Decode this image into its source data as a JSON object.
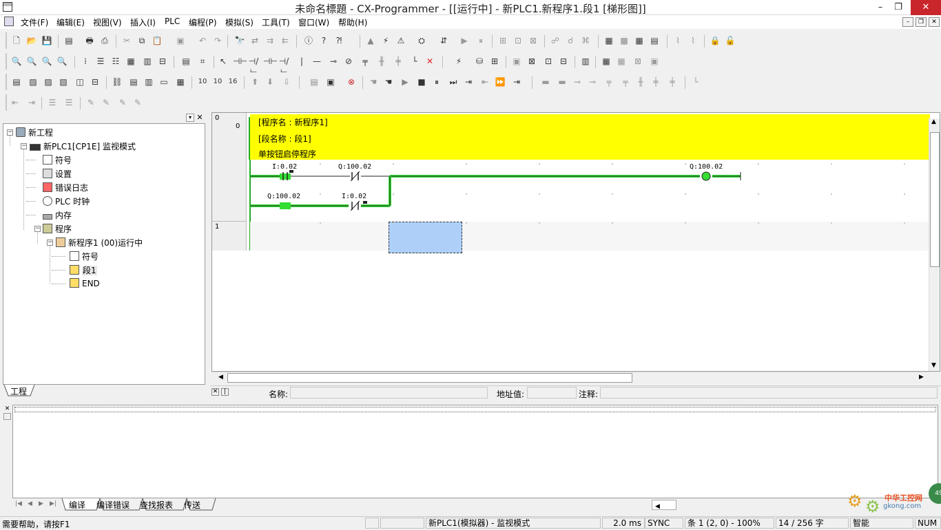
{
  "window": {
    "title": "未命名標題 - CX-Programmer - [[运行中] - 新PLC1.新程序1.段1 [梯形图]]",
    "minimize": "–",
    "restore": "❐",
    "close": "✕"
  },
  "menu": [
    "文件(F)",
    "编辑(E)",
    "视图(V)",
    "插入(I)",
    "PLC",
    "编程(P)",
    "模拟(S)",
    "工具(T)",
    "窗口(W)",
    "帮助(H)"
  ],
  "tree": {
    "root": "新工程",
    "plc": "新PLC1[CP1E] 监视模式",
    "items": [
      "符号",
      "设置",
      "错误日志",
      "PLC 时钟",
      "内存"
    ],
    "programs": "程序",
    "program1": "新程序1 (00)运行中",
    "sub_items": [
      "符号",
      "段1",
      "END"
    ],
    "tab": "工程"
  },
  "ladder": {
    "rungs": [
      {
        "index": "0",
        "step": "0"
      },
      {
        "index": "1",
        "step": ""
      }
    ],
    "comments": [
      "[程序名 : 新程序1]",
      "[段名称 : 段1]",
      "单按钮启停程序"
    ],
    "contacts": [
      {
        "label": "I:0.02"
      },
      {
        "label": "Q:100.02"
      },
      {
        "label": "Q:100.02"
      },
      {
        "label": "I:0.02"
      }
    ],
    "coil": {
      "label": "Q:100.02"
    }
  },
  "infobar": {
    "name_label": "名称:",
    "address_label": "地址值:",
    "comment_label": "注释:"
  },
  "output_tabs": [
    "编译",
    "编译错误",
    "查找报表",
    "传送"
  ],
  "status": {
    "help": "需要帮助，请按F1",
    "plc": "新PLC1(模拟器) - 监视模式",
    "cycle": "2.0 ms",
    "sync": "SYNC",
    "rung_pos": "条 1 (2, 0)  - 100%",
    "count": "14 / 256 字",
    "mode": "智能",
    "num": "NUM"
  },
  "watermark": {
    "text1": "中华工控网",
    "text2": "gkong.com"
  },
  "colors": {
    "comment_bg": "#ffff00",
    "power_flow": "#33dd33",
    "selection": "#aed0f8"
  }
}
